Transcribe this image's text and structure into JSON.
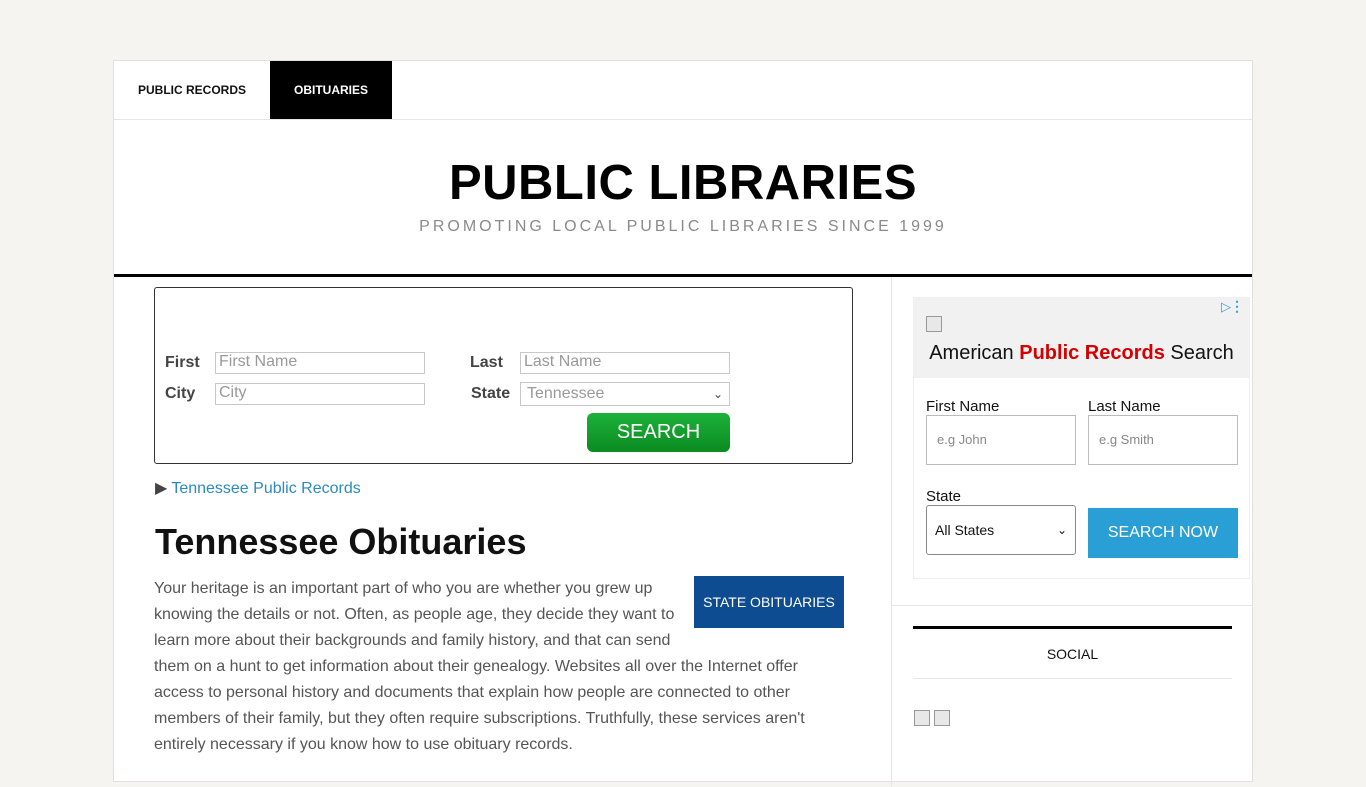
{
  "nav": {
    "items": [
      {
        "label": "PUBLIC RECORDS"
      },
      {
        "label": "OBITUARIES"
      }
    ]
  },
  "header": {
    "title": "PUBLIC LIBRARIES",
    "tagline": "PROMOTING LOCAL PUBLIC LIBRARIES SINCE 1999"
  },
  "search": {
    "first_label": "First",
    "first_placeholder": "First Name",
    "last_label": "Last",
    "last_placeholder": "Last Name",
    "city_label": "City",
    "city_placeholder": "City",
    "state_label": "State",
    "state_value": "Tennessee",
    "button": "SEARCH"
  },
  "records_link": "Tennessee Public Records",
  "main": {
    "heading": "Tennessee Obituaries",
    "state_button": "STATE OBITUARIES",
    "body": "Your heritage is an important part of who you are whether you grew up knowing the details or not. Often, as people age, they decide they want to learn more about their backgrounds and family history, and that can send them on a hunt to get information about their genealogy. Websites all over the Internet offer access to personal history and documents that explain how people are connected to other members of their family, but they often require subscriptions. Truthfully, these services aren't entirely necessary if you know how to use obituary records."
  },
  "ad": {
    "title_pre": "American ",
    "title_red": "Public Records",
    "title_post": " Search",
    "first_label": "First Name",
    "first_placeholder": "e.g John",
    "last_label": "Last Name",
    "last_placeholder": "e.g Smith",
    "state_label": "State",
    "state_value": "All States",
    "button": "SEARCH NOW"
  },
  "sidebar": {
    "social_title": "SOCIAL"
  }
}
